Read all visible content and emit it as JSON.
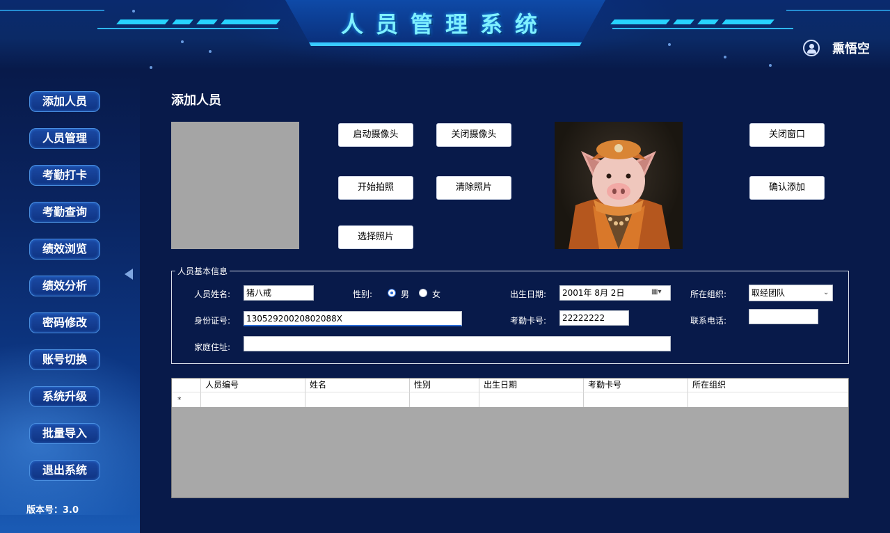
{
  "header": {
    "title": "人员管理系统",
    "user_name": "熏悟空"
  },
  "sidebar": {
    "items": [
      {
        "label": "添加人员"
      },
      {
        "label": "人员管理"
      },
      {
        "label": "考勤打卡"
      },
      {
        "label": "考勤查询"
      },
      {
        "label": "绩效浏览"
      },
      {
        "label": "绩效分析"
      },
      {
        "label": "密码修改"
      },
      {
        "label": "账号切换"
      },
      {
        "label": "系统升级"
      },
      {
        "label": "批量导入"
      },
      {
        "label": "退出系统"
      }
    ],
    "version": "版本号：3.0"
  },
  "main": {
    "section_title": "添加人员",
    "buttons": {
      "start_camera": "启动摄像头",
      "close_camera": "关闭摄像头",
      "take_photo": "开始拍照",
      "clear_photo": "清除照片",
      "select_photo": "选择照片",
      "close_window": "关闭窗口",
      "confirm_add": "确认添加"
    },
    "form": {
      "group_title": "人员基本信息",
      "name_label": "人员姓名:",
      "name_value": "猪八戒",
      "gender_label": "性别:",
      "gender_male": "男",
      "gender_female": "女",
      "gender_selected": "男",
      "birth_label": "出生日期:",
      "birth_value": "2001年  8月  2日",
      "org_label": "所在组织:",
      "org_value": "取经团队",
      "id_label": "身份证号:",
      "id_value": "13052920020802088X",
      "card_label": "考勤卡号:",
      "card_value": "22222222",
      "phone_label": "联系电话:",
      "phone_value": "",
      "address_label": "家庭住址:",
      "address_value": ""
    },
    "table": {
      "columns": [
        "人员编号",
        "姓名",
        "性别",
        "出生日期",
        "考勤卡号",
        "所在组织"
      ],
      "new_row_marker": "*"
    }
  },
  "colors": {
    "background": "#081a4a",
    "accent": "#27d3ff",
    "nav_button": "#1b4aa5"
  }
}
